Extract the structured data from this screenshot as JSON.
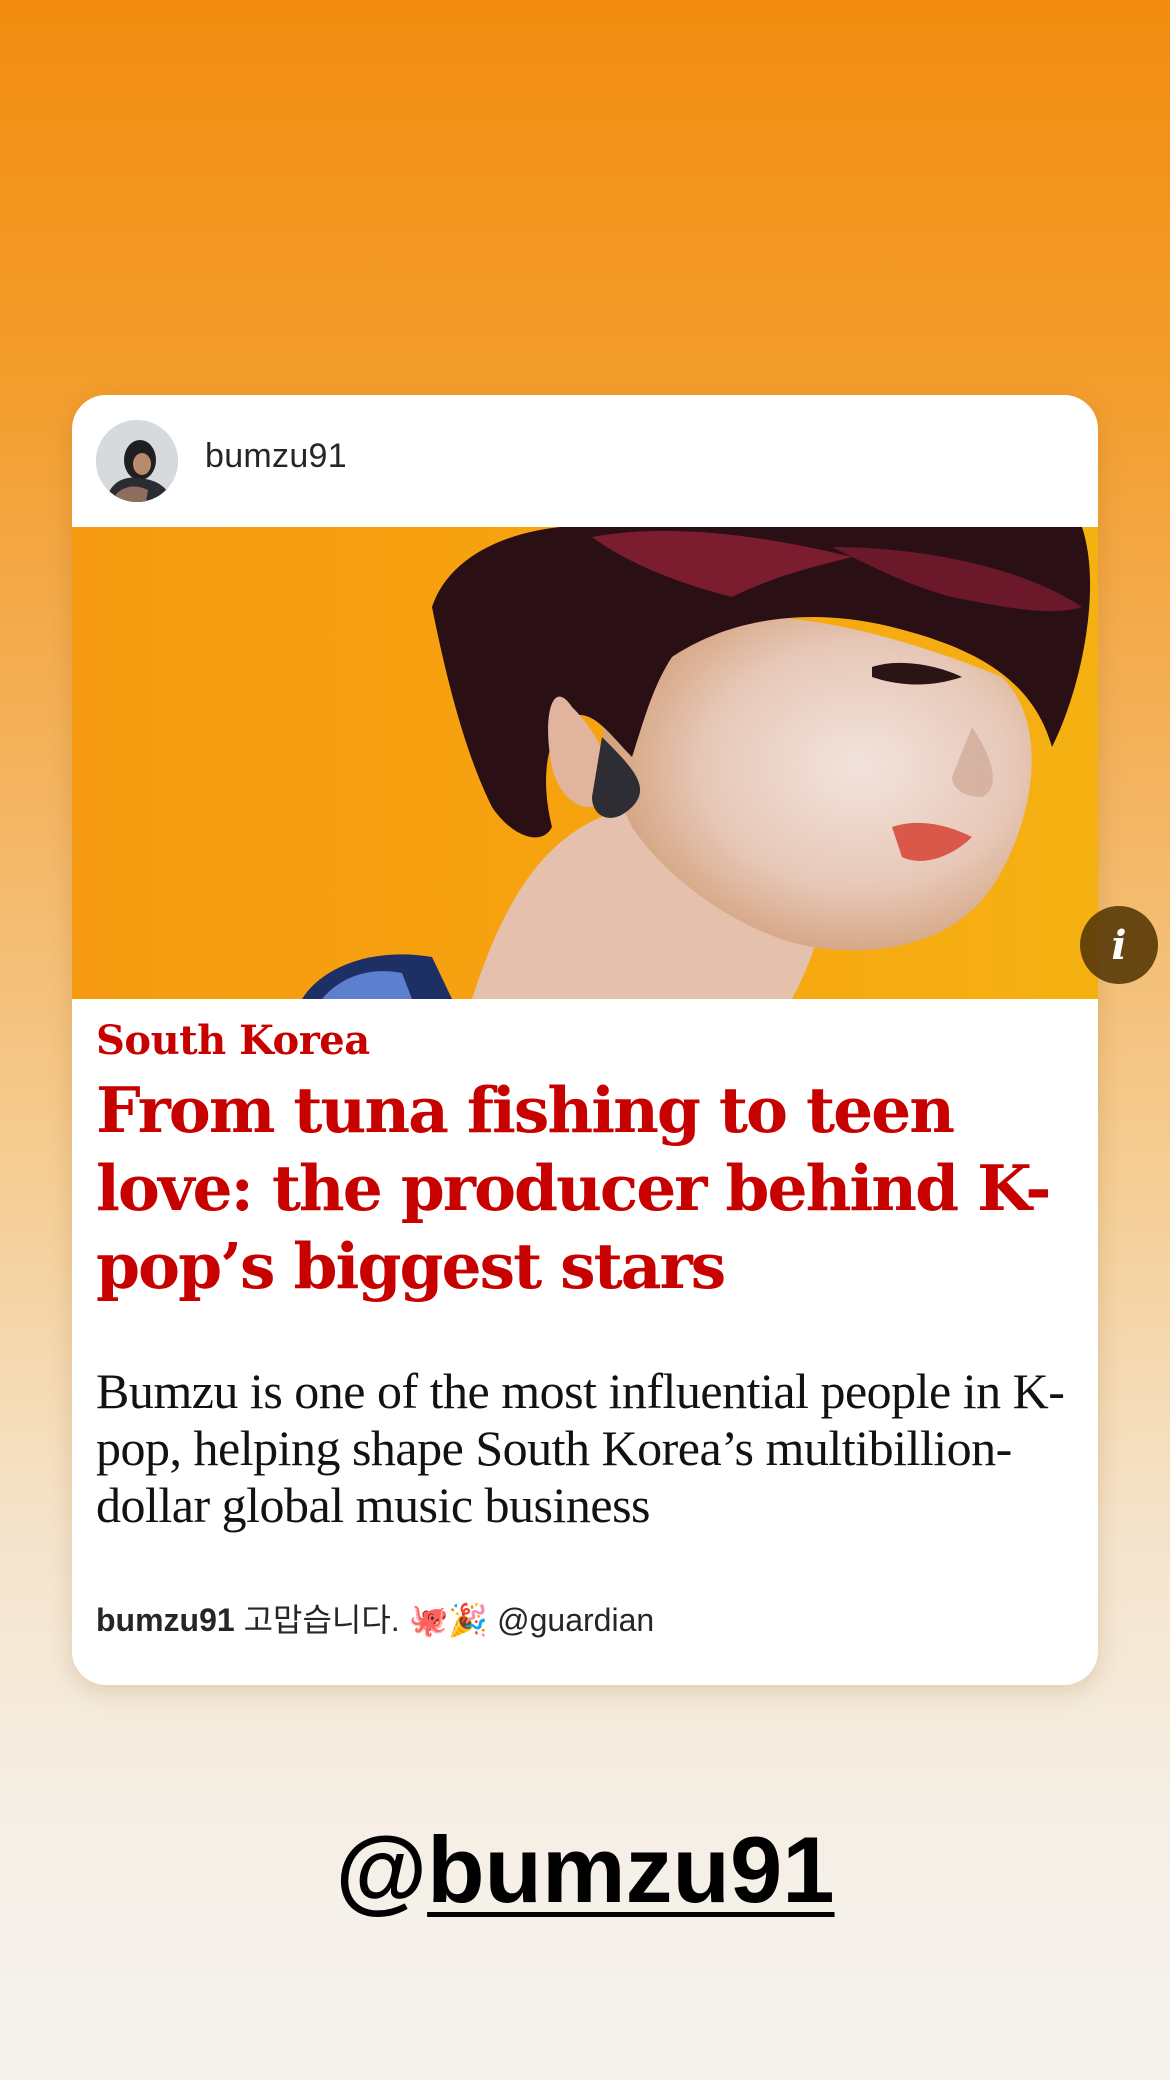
{
  "post": {
    "username": "bumzu91",
    "avatar_icon": "profile-avatar"
  },
  "article": {
    "kicker": "South Korea",
    "headline": "From tuna fishing to teen love: the producer behind K-pop’s biggest stars",
    "standfirst": "Bumzu is one of the most influential people in K-pop, helping shape South Korea’s multibillion-dollar global music business",
    "info_label": "i",
    "accent_color": "#c70000"
  },
  "caption": {
    "user": "bumzu91",
    "text": "고맙습니다. 🐙🎉 @guardian"
  },
  "mention": {
    "at": "@",
    "handle": "bumzu91"
  },
  "colors": {
    "background_top": "#f28c0f",
    "background_bottom": "#f5f2ee",
    "hero_background": "#f4a10f"
  }
}
